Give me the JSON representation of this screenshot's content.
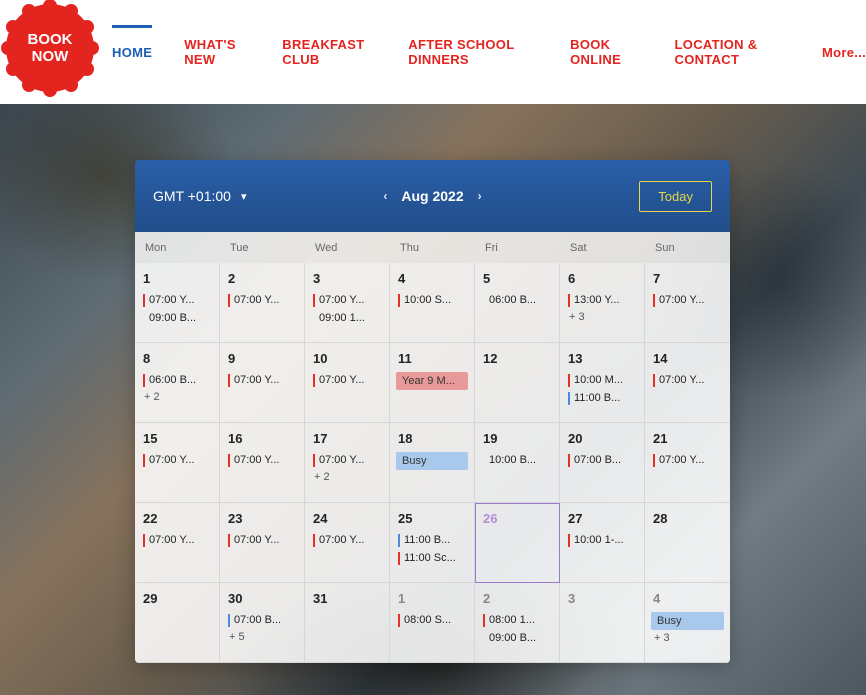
{
  "badge": {
    "line1": "BOOK",
    "line2": "NOW"
  },
  "nav": {
    "items": [
      {
        "label": "HOME",
        "active": true
      },
      {
        "label": "WHAT'S NEW"
      },
      {
        "label": "BREAKFAST CLUB"
      },
      {
        "label": "AFTER SCHOOL DINNERS"
      },
      {
        "label": "BOOK ONLINE"
      },
      {
        "label": "LOCATION & CONTACT"
      }
    ],
    "more": "More..."
  },
  "calendar": {
    "timezone": "GMT +01:00",
    "month": "Aug 2022",
    "today_btn": "Today",
    "dow": [
      "Mon",
      "Tue",
      "Wed",
      "Thu",
      "Fri",
      "Sat",
      "Sun"
    ],
    "cells": [
      {
        "n": "1",
        "ev": [
          {
            "c": "red",
            "t": "07:00 Y..."
          },
          {
            "c": "plain",
            "t": "09:00 B..."
          }
        ]
      },
      {
        "n": "2",
        "ev": [
          {
            "c": "red",
            "t": "07:00 Y..."
          }
        ]
      },
      {
        "n": "3",
        "ev": [
          {
            "c": "red",
            "t": "07:00 Y..."
          },
          {
            "c": "plain",
            "t": "09:00 1..."
          }
        ]
      },
      {
        "n": "4",
        "ev": [
          {
            "c": "red",
            "t": "10:00 S..."
          }
        ]
      },
      {
        "n": "5",
        "ev": [
          {
            "c": "plain",
            "t": "06:00 B..."
          }
        ]
      },
      {
        "n": "6",
        "ev": [
          {
            "c": "red",
            "t": "13:00 Y..."
          }
        ],
        "more": "+ 3"
      },
      {
        "n": "7",
        "ev": [
          {
            "c": "red",
            "t": "07:00 Y..."
          }
        ]
      },
      {
        "n": "8",
        "ev": [
          {
            "c": "red",
            "t": "06:00 B..."
          }
        ],
        "more": "+ 2"
      },
      {
        "n": "9",
        "ev": [
          {
            "c": "red",
            "t": "07:00 Y..."
          }
        ]
      },
      {
        "n": "10",
        "ev": [
          {
            "c": "red",
            "t": "07:00 Y..."
          }
        ]
      },
      {
        "n": "11",
        "ev": [
          {
            "c": "block",
            "t": "Year 9 M..."
          }
        ]
      },
      {
        "n": "12",
        "ev": []
      },
      {
        "n": "13",
        "ev": [
          {
            "c": "red",
            "t": "10:00 M..."
          },
          {
            "c": "blue",
            "t": "11:00 B..."
          }
        ]
      },
      {
        "n": "14",
        "ev": [
          {
            "c": "red",
            "t": "07:00 Y..."
          }
        ]
      },
      {
        "n": "15",
        "ev": [
          {
            "c": "red",
            "t": "07:00 Y..."
          }
        ]
      },
      {
        "n": "16",
        "ev": [
          {
            "c": "red",
            "t": "07:00 Y..."
          }
        ]
      },
      {
        "n": "17",
        "ev": [
          {
            "c": "red",
            "t": "07:00 Y..."
          }
        ],
        "more": "+ 2"
      },
      {
        "n": "18",
        "ev": [
          {
            "c": "block-blue",
            "t": "Busy"
          }
        ]
      },
      {
        "n": "19",
        "ev": [
          {
            "c": "plain",
            "t": "10:00 B..."
          }
        ]
      },
      {
        "n": "20",
        "ev": [
          {
            "c": "red",
            "t": "07:00 B..."
          }
        ]
      },
      {
        "n": "21",
        "ev": [
          {
            "c": "red",
            "t": "07:00 Y..."
          }
        ]
      },
      {
        "n": "22",
        "ev": [
          {
            "c": "red",
            "t": "07:00 Y..."
          }
        ]
      },
      {
        "n": "23",
        "ev": [
          {
            "c": "red",
            "t": "07:00 Y..."
          }
        ]
      },
      {
        "n": "24",
        "ev": [
          {
            "c": "red",
            "t": "07:00 Y..."
          }
        ]
      },
      {
        "n": "25",
        "ev": [
          {
            "c": "blue",
            "t": "11:00 B..."
          },
          {
            "c": "red",
            "t": "11:00 Sc..."
          }
        ]
      },
      {
        "n": "26",
        "today": true,
        "ev": []
      },
      {
        "n": "27",
        "ev": [
          {
            "c": "red",
            "t": "10:00 1-..."
          }
        ]
      },
      {
        "n": "28",
        "ev": []
      },
      {
        "n": "29",
        "ev": []
      },
      {
        "n": "30",
        "ev": [
          {
            "c": "blue",
            "t": "07:00 B..."
          }
        ],
        "more": "+ 5"
      },
      {
        "n": "31",
        "ev": []
      },
      {
        "n": "1",
        "other": true,
        "ev": [
          {
            "c": "red",
            "t": "08:00 S..."
          }
        ]
      },
      {
        "n": "2",
        "other": true,
        "ev": [
          {
            "c": "red",
            "t": "08:00 1..."
          },
          {
            "c": "plain",
            "t": "09:00 B..."
          }
        ]
      },
      {
        "n": "3",
        "other": true,
        "ev": []
      },
      {
        "n": "4",
        "other": true,
        "ev": [
          {
            "c": "block-blue",
            "t": "Busy"
          }
        ],
        "more": "+ 3"
      }
    ]
  }
}
